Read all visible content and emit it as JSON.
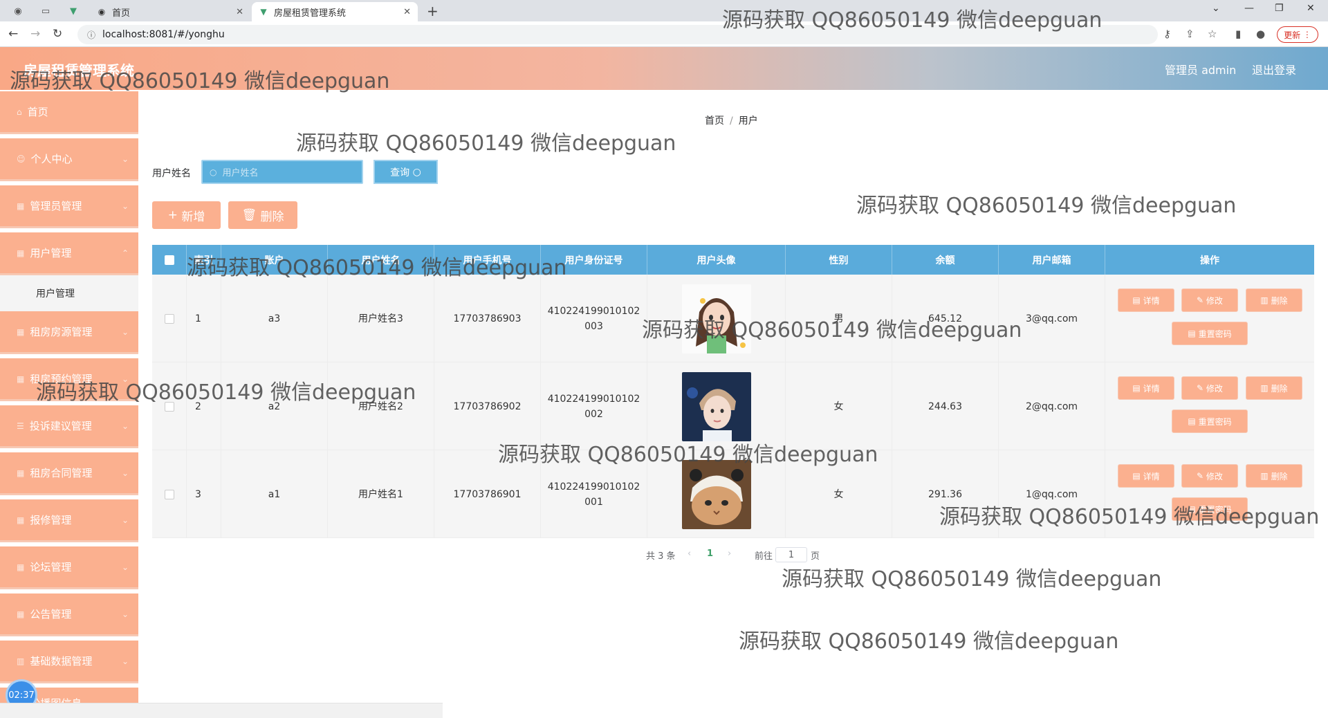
{
  "browser": {
    "tabs": [
      {
        "label": "首页",
        "icon": "globe-icon"
      },
      {
        "label": "房屋租赁管理系统",
        "icon": "vue-logo-icon"
      }
    ],
    "url": "localhost:8081/#/yonghu",
    "update_label": "更新"
  },
  "header": {
    "title": "房屋租赁管理系统",
    "user_label": "管理员 admin",
    "logout_label": "退出登录"
  },
  "sidebar": {
    "items": [
      {
        "label": "首页"
      },
      {
        "label": "个人中心"
      },
      {
        "label": "管理员管理"
      },
      {
        "label": "用户管理"
      },
      {
        "label": "租房房源管理"
      },
      {
        "label": "租房预约管理"
      },
      {
        "label": "投诉建议管理"
      },
      {
        "label": "租房合同管理"
      },
      {
        "label": "报修管理"
      },
      {
        "label": "论坛管理"
      },
      {
        "label": "公告管理"
      },
      {
        "label": "基础数据管理"
      }
    ],
    "submenu_active": "用户管理",
    "partial_item": "轮播图信息",
    "clock": "02:37"
  },
  "breadcrumb": {
    "home": "首页",
    "sep": "/",
    "current": "用户"
  },
  "search": {
    "label": "用户姓名",
    "placeholder": "用户姓名",
    "query_label": "查询"
  },
  "actions": {
    "add_label": "新增",
    "delete_label": "删除"
  },
  "table": {
    "headers": [
      "",
      "索引",
      "账户",
      "用户姓名",
      "用户手机号",
      "用户身份证号",
      "用户头像",
      "性别",
      "余额",
      "用户邮箱",
      "操作"
    ],
    "rows": [
      {
        "index": "1",
        "account": "a3",
        "name": "用户姓名3",
        "phone": "17703786903",
        "idcard": "410224199010102003",
        "gender": "男",
        "balance": "645.12",
        "email": "3@qq.com",
        "avatar": "cartoon-girl-avatar"
      },
      {
        "index": "2",
        "account": "a2",
        "name": "用户姓名2",
        "phone": "17703786902",
        "idcard": "410224199010102002",
        "gender": "女",
        "balance": "244.63",
        "email": "2@qq.com",
        "avatar": "young-man-avatar"
      },
      {
        "index": "3",
        "account": "a1",
        "name": "用户姓名1",
        "phone": "17703786901",
        "idcard": "410224199010102001",
        "gender": "女",
        "balance": "291.36",
        "email": "1@qq.com",
        "avatar": "cat-avatar"
      }
    ],
    "op_labels": {
      "detail": "详情",
      "edit": "修改",
      "delete": "删除",
      "reset": "重置密码"
    }
  },
  "pagination": {
    "total": "共 3 条",
    "current": "1",
    "goto": "前往",
    "page_input": "1",
    "page_unit": "页"
  },
  "watermark": "源码获取 QQ86050149 微信deepguan",
  "colors": {
    "accent": "#fbb08f",
    "primary": "#5aabdb"
  }
}
